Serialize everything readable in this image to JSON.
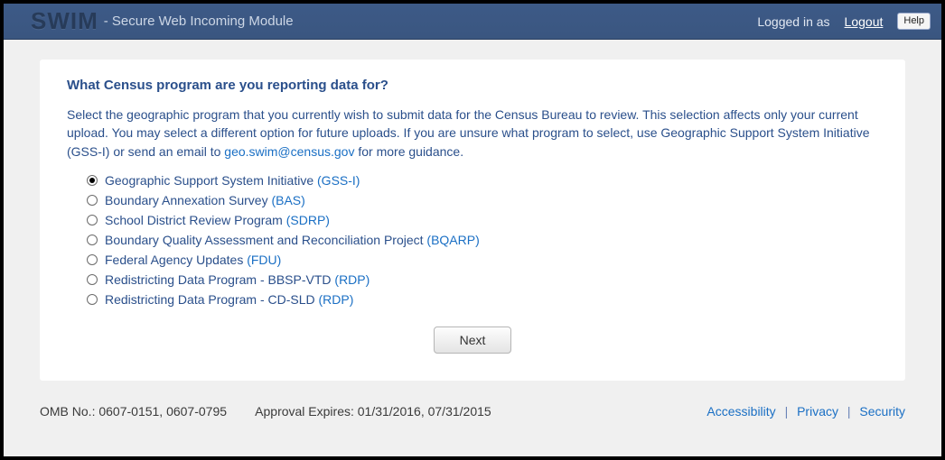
{
  "header": {
    "logo": "SWIM",
    "subtitle": "- Secure Web Incoming Module",
    "logged_in": "Logged in as",
    "logout": "Logout",
    "help": "Help"
  },
  "main": {
    "title": "What Census program are you reporting data for?",
    "intro_pre": "Select the geographic program that you currently wish to submit data for the Census Bureau to review. This selection affects only your current upload. You may select a different option for future uploads. If you are unsure what program to select, use Geographic Support System Initiative (GSS-I) or send an email to ",
    "intro_email": "geo.swim@census.gov",
    "intro_post": " for more guidance.",
    "options": [
      {
        "label": "Geographic Support System Initiative ",
        "abbr": "(GSS-I)",
        "selected": true
      },
      {
        "label": "Boundary Annexation Survey ",
        "abbr": "(BAS)",
        "selected": false
      },
      {
        "label": "School District Review Program ",
        "abbr": "(SDRP)",
        "selected": false
      },
      {
        "label": "Boundary Quality Assessment and Reconciliation Project ",
        "abbr": "(BQARP)",
        "selected": false
      },
      {
        "label": "Federal Agency Updates ",
        "abbr": "(FDU)",
        "selected": false
      },
      {
        "label": "Redistricting Data Program - BBSP-VTD ",
        "abbr": "(RDP)",
        "selected": false
      },
      {
        "label": "Redistricting Data Program - CD-SLD ",
        "abbr": "(RDP)",
        "selected": false
      }
    ],
    "next": "Next"
  },
  "footer": {
    "omb": "OMB No.: 0607-0151, 0607-0795",
    "approval": "Approval Expires: 01/31/2016, 07/31/2015",
    "links": {
      "accessibility": "Accessibility",
      "privacy": "Privacy",
      "security": "Security"
    }
  }
}
